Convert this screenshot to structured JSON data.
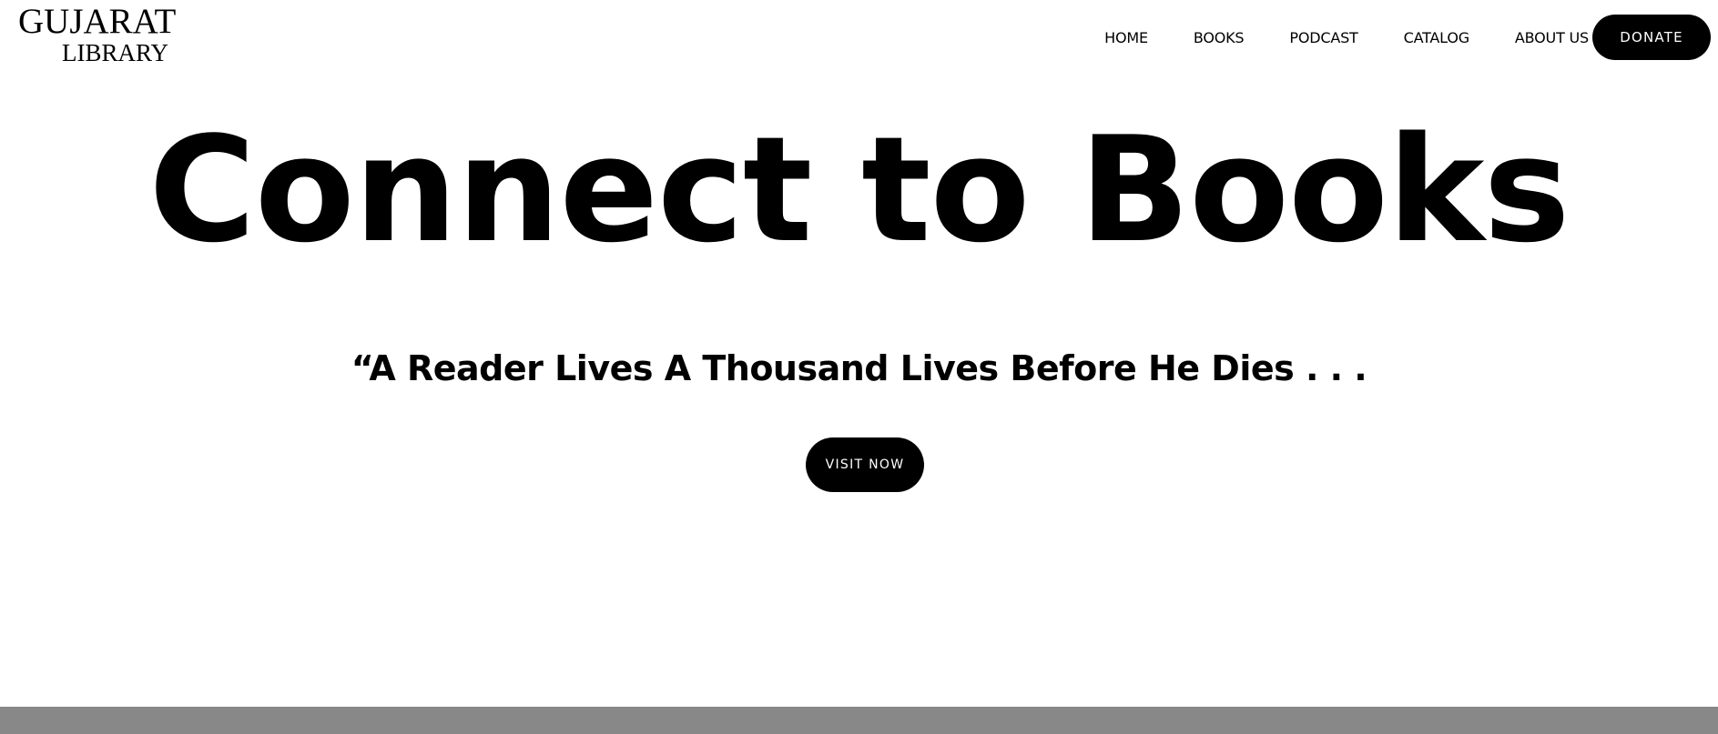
{
  "logo": {
    "line1": "GUJARAT",
    "line2": "LIBRARY"
  },
  "nav": {
    "items": [
      {
        "label": "HOME"
      },
      {
        "label": "BOOKS"
      },
      {
        "label": "PODCAST"
      },
      {
        "label": "CATALOG"
      },
      {
        "label": "ABOUT US"
      }
    ],
    "donate_label": "DONATE"
  },
  "hero": {
    "title": "Connect to Books",
    "quote": "“A Reader Lives A Thousand Lives Before He Dies . . .",
    "cta_label": "VISIT NOW"
  },
  "colors": {
    "background": "#ffffff",
    "text": "#000000",
    "button_bg": "#000000",
    "button_text": "#ffffff",
    "footer_band": "#888888"
  }
}
